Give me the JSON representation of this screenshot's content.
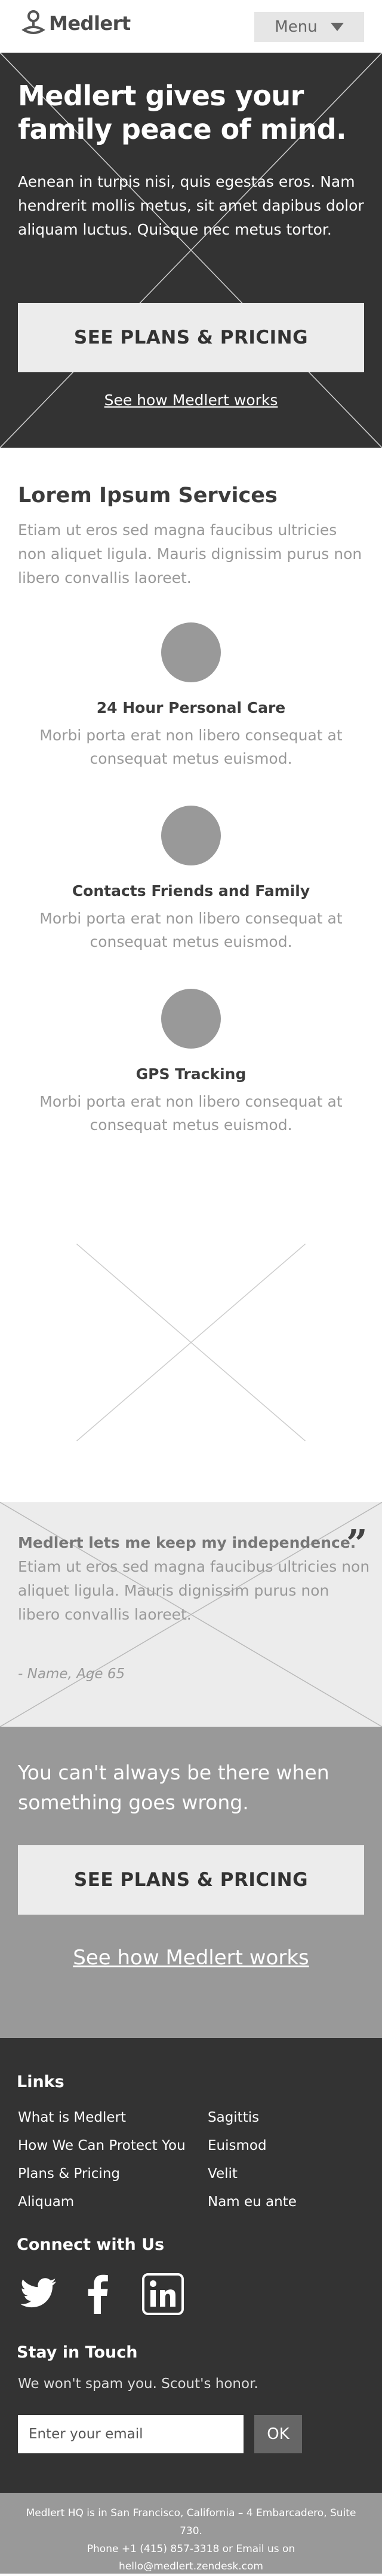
{
  "header": {
    "logo_text": "Medlert",
    "menu_label": "Menu"
  },
  "hero": {
    "title": "Medlert gives your family peace of mind.",
    "body": "Aenean in turpis nisi, quis egestas eros. Nam hendrerit mollis metus, sit amet dapibus dolor aliquam luctus. Quisque nec metus tortor.",
    "cta_label": "SEE PLANS & PRICING",
    "secondary_link": "See how Medlert works"
  },
  "services": {
    "title": "Lorem Ipsum Services",
    "intro": "Etiam ut eros sed magna faucibus ultricies non aliquet ligula. Mauris dignissim purus non libero convallis laoreet.",
    "items": [
      {
        "name": "24 Hour Personal Care",
        "description": "Morbi porta erat non libero consequat at consequat metus euismod."
      },
      {
        "name": "Contacts Friends and Family",
        "description": "Morbi porta erat non libero consequat at consequat metus euismod."
      },
      {
        "name": "GPS Tracking",
        "description": "Morbi porta erat non libero consequat at consequat metus euismod."
      }
    ]
  },
  "testimonial": {
    "headline": "Medlert lets me keep my independence.",
    "body": "Etiam ut eros sed magna faucibus ultricies non aliquet ligula. Mauris dignissim purus non libero convallis laoreet.",
    "author": "- Name, Age 65",
    "quote_icon": "quote-icon"
  },
  "cta": {
    "text": "You can't always be there when something goes wrong.",
    "button_label": "SEE PLANS & PRICING",
    "secondary_link": "See how Medlert works"
  },
  "footer": {
    "links_heading": "Links",
    "links": [
      {
        "label": "What is Medlert"
      },
      {
        "label": "How We Can Protect You"
      },
      {
        "label": "Plans & Pricing"
      },
      {
        "label": "Aliquam"
      },
      {
        "label": "Sagittis"
      },
      {
        "label": "Euismod"
      },
      {
        "label": "Velit"
      },
      {
        "label": "Nam eu ante"
      }
    ],
    "connect_heading": "Connect with Us",
    "social_icons": [
      "twitter-icon",
      "facebook-icon",
      "linkedin-icon"
    ],
    "stay_heading": "Stay in Touch",
    "stay_note": "We won't spam you. Scout's honor.",
    "email_placeholder": "Enter your email",
    "submit_label": "OK"
  },
  "bottom": {
    "address": "Medlert HQ is in San Francisco, California – 4 Embarcadero, Suite 730.",
    "contact": "Phone +1 (415) 857-3318 or Email us on hello@medlert.zendesk.com"
  },
  "colors": {
    "dark": "#333333",
    "mid_gray": "#999999",
    "light_gray": "#ececec",
    "white": "#ffffff"
  }
}
